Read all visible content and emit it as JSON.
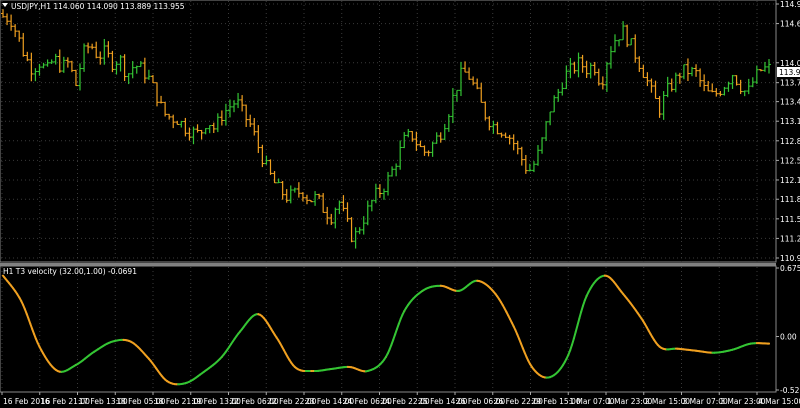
{
  "symbol_header": "USDJPY,H1  114.060 114.090 113.889 113.955",
  "indicator_header": "H1 T3 velocity (32.00,1.00) -0.0691",
  "current_price_tag": "113.955",
  "colors": {
    "background": "#000000",
    "up": "#34c534",
    "down": "#f0a020",
    "grid": "#3a3a3a",
    "axis_text": "#ffffff"
  },
  "icons": [
    "dropdown-triangle-icon"
  ],
  "chart_data": [
    {
      "type": "candlestick",
      "title": "USDJPY,H1",
      "ohlc_last": {
        "open": 114.06,
        "high": 114.09,
        "low": 113.889,
        "close": 113.955
      },
      "y_ticks": [
        "114.980",
        "114.670",
        "114.050",
        "113.735",
        "113.435",
        "113.125",
        "112.815",
        "112.505",
        "112.195",
        "111.890",
        "111.580",
        "111.270",
        "110.960"
      ],
      "ylim": [
        110.96,
        114.98
      ],
      "x_ticks": [
        "16 Feb 2016",
        "16 Feb 21:00",
        "17 Feb 13:00",
        "18 Feb 05:00",
        "18 Feb 21:00",
        "19 Feb 13:00",
        "22 Feb 06:00",
        "22 Feb 22:00",
        "23 Feb 14:00",
        "24 Feb 06:00",
        "24 Feb 22:00",
        "25 Feb 14:00",
        "26 Feb 06:00",
        "26 Feb 22:00",
        "29 Feb 15:00",
        "1 Mar 07:00",
        "1 Mar 23:00",
        "2 Mar 15:00",
        "3 Mar 07:00",
        "3 Mar 23:00",
        "4 Mar 15:00"
      ],
      "close_path": [
        [
          0,
          114.78
        ],
        [
          4,
          114.75
        ],
        [
          8,
          114.48
        ],
        [
          12,
          114.15
        ],
        [
          16,
          113.95
        ],
        [
          20,
          114.05
        ],
        [
          24,
          113.92
        ],
        [
          28,
          114.12
        ],
        [
          32,
          113.98
        ],
        [
          36,
          114.05
        ],
        [
          40,
          113.7
        ],
        [
          44,
          114.2
        ],
        [
          48,
          114.35
        ],
        [
          52,
          114.15
        ],
        [
          56,
          114.22
        ],
        [
          60,
          114.05
        ],
        [
          64,
          114.12
        ],
        [
          68,
          113.85
        ],
        [
          72,
          114.02
        ],
        [
          76,
          113.95
        ],
        [
          80,
          113.8
        ],
        [
          84,
          113.55
        ],
        [
          88,
          113.25
        ],
        [
          92,
          113.18
        ],
        [
          96,
          113.15
        ],
        [
          100,
          113.02
        ],
        [
          104,
          112.95
        ],
        [
          108,
          112.92
        ],
        [
          112,
          113.15
        ],
        [
          116,
          113.0
        ],
        [
          120,
          113.22
        ],
        [
          124,
          113.35
        ],
        [
          128,
          113.45
        ],
        [
          132,
          113.22
        ],
        [
          136,
          113.05
        ],
        [
          140,
          112.72
        ],
        [
          144,
          112.42
        ],
        [
          148,
          112.18
        ],
        [
          152,
          112.02
        ],
        [
          156,
          111.92
        ],
        [
          160,
          111.98
        ],
        [
          164,
          112.02
        ],
        [
          168,
          111.88
        ],
        [
          172,
          111.92
        ],
        [
          176,
          111.72
        ],
        [
          180,
          111.62
        ],
        [
          184,
          111.88
        ],
        [
          188,
          111.55
        ],
        [
          192,
          111.25
        ],
        [
          196,
          111.48
        ],
        [
          200,
          111.72
        ],
        [
          204,
          111.95
        ],
        [
          208,
          112.05
        ],
        [
          212,
          112.25
        ],
        [
          216,
          112.52
        ],
        [
          220,
          112.82
        ],
        [
          224,
          112.92
        ],
        [
          228,
          112.72
        ],
        [
          232,
          112.62
        ],
        [
          236,
          112.78
        ],
        [
          240,
          112.95
        ],
        [
          244,
          113.25
        ],
        [
          248,
          113.62
        ],
        [
          252,
          113.92
        ],
        [
          256,
          113.82
        ],
        [
          260,
          113.55
        ],
        [
          264,
          113.25
        ],
        [
          268,
          113.08
        ],
        [
          272,
          113.0
        ],
        [
          276,
          112.95
        ],
        [
          280,
          112.78
        ],
        [
          284,
          112.55
        ],
        [
          288,
          112.32
        ],
        [
          292,
          112.48
        ],
        [
          296,
          112.85
        ],
        [
          300,
          113.32
        ],
        [
          304,
          113.55
        ],
        [
          308,
          113.85
        ],
        [
          312,
          113.95
        ],
        [
          316,
          114.05
        ],
        [
          320,
          113.95
        ],
        [
          324,
          114.02
        ],
        [
          328,
          113.7
        ],
        [
          332,
          114.2
        ],
        [
          336,
          114.45
        ],
        [
          340,
          114.55
        ],
        [
          344,
          114.35
        ],
        [
          348,
          114.1
        ],
        [
          352,
          113.85
        ],
        [
          356,
          113.55
        ],
        [
          360,
          113.32
        ],
        [
          364,
          113.6
        ],
        [
          368,
          113.75
        ],
        [
          372,
          113.92
        ],
        [
          376,
          113.92
        ],
        [
          380,
          113.88
        ],
        [
          384,
          113.65
        ],
        [
          388,
          113.52
        ],
        [
          392,
          113.58
        ],
        [
          396,
          113.72
        ],
        [
          400,
          113.88
        ],
        [
          404,
          113.7
        ],
        [
          408,
          113.55
        ],
        [
          412,
          113.8
        ],
        [
          416,
          113.95
        ],
        [
          420,
          113.96
        ]
      ]
    },
    {
      "type": "line",
      "title": "H1 T3 velocity (32.00,1.00)",
      "current_value": -0.0691,
      "y_ticks": [
        "0.6754",
        "0.00",
        "-0.5271"
      ],
      "ylim": [
        -0.5271,
        0.6754
      ],
      "series": [
        {
          "x": [
            0,
            10,
            20,
            30,
            40,
            50,
            60,
            70,
            80,
            90,
            100,
            110,
            120,
            130,
            140,
            150,
            160,
            170,
            180,
            190,
            200,
            210,
            220,
            230,
            240,
            250,
            260,
            270,
            280,
            290,
            300,
            310,
            320,
            330,
            340,
            350,
            360,
            370,
            380,
            390,
            400,
            410,
            420
          ],
          "values": [
            0.6,
            0.35,
            -0.1,
            -0.34,
            -0.28,
            -0.15,
            -0.05,
            -0.05,
            -0.22,
            -0.44,
            -0.46,
            -0.35,
            -0.2,
            0.05,
            0.22,
            -0.01,
            -0.3,
            -0.34,
            -0.32,
            -0.3,
            -0.34,
            -0.2,
            0.25,
            0.45,
            0.5,
            0.45,
            0.55,
            0.42,
            0.1,
            -0.3,
            -0.4,
            -0.18,
            0.4,
            0.6,
            0.42,
            0.18,
            -0.1,
            -0.12,
            -0.14,
            -0.16,
            -0.13,
            -0.07,
            -0.07
          ]
        }
      ]
    }
  ]
}
